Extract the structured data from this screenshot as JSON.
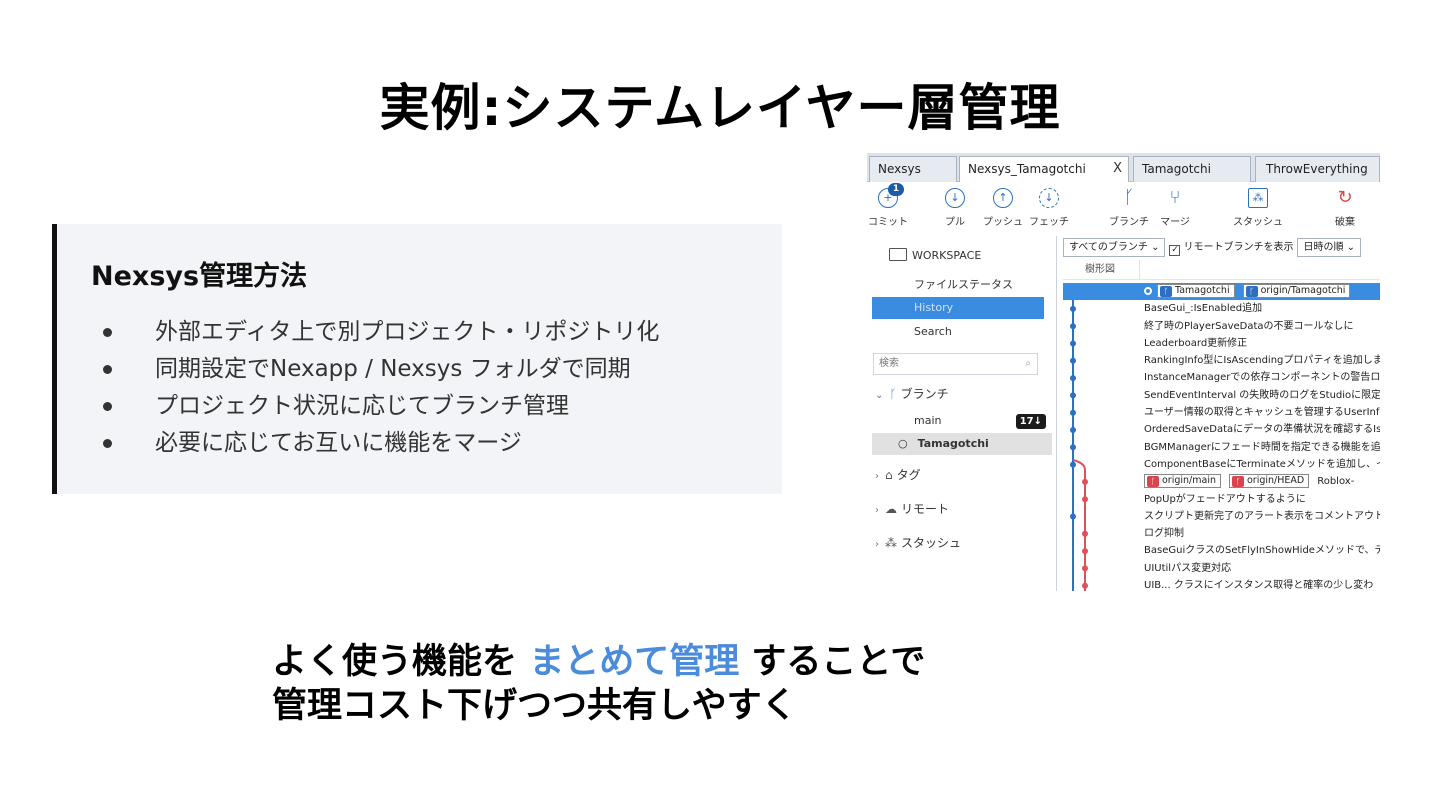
{
  "slide": {
    "title": "実例:システムレイヤー層管理",
    "info_heading": "Nexsys管理方法",
    "bullets": [
      "外部エディタ上で別プロジェクト・リポジトリ化",
      "同期設定でNexapp / Nexsys フォルダで同期",
      "プロジェクト状況に応じてブランチ管理",
      "必要に応じてお互いに機能をマージ"
    ],
    "bottom_line1_part1": "よく使う機能を ",
    "bottom_line1_highlight": "まとめて管理",
    "bottom_line1_part2": " することで",
    "bottom_line2": "管理コスト下げつつ共有しやすく",
    "highlight_color": "#4a8bdc"
  },
  "app": {
    "tabs": [
      "Nexsys",
      "Nexsys_Tamagotchi",
      "Tamagotchi",
      "ThrowEverything"
    ],
    "tab_close": "X",
    "toolbar": {
      "commit": "コミット",
      "commit_badge": "1",
      "pull": "プル",
      "push": "プッシュ",
      "fetch": "フェッチ",
      "branch": "ブランチ",
      "merge": "マージ",
      "stash": "スタッシュ",
      "discard": "破棄"
    },
    "sidebar": {
      "workspace": "WORKSPACE",
      "items": [
        "ファイルステータス",
        "History",
        "Search"
      ],
      "search_placeholder": "検索",
      "branches_group": "ブランチ",
      "branches": [
        {
          "name": "main",
          "count": "17↓"
        },
        {
          "name": "Tamagotchi"
        }
      ],
      "tags_group": "タグ",
      "remotes_group": "リモート",
      "stashes_group": "スタッシュ"
    },
    "filters": {
      "all_branches": "すべてのブランチ ⌄",
      "show_remote": "リモートブランチを表示",
      "date_order": "日時の順 ⌄",
      "graph_col": "樹形図"
    },
    "commits": [
      {
        "tags": [
          "Tamagotchi",
          "origin/Tamagotchi"
        ],
        "message": ""
      },
      {
        "message": "BaseGui_:IsEnabled追加"
      },
      {
        "message": "終了時のPlayerSaveDataの不要コールなしに"
      },
      {
        "message": "Leaderboard更新修正"
      },
      {
        "message": "RankingInfo型にIsAscendingプロパティを追加しま"
      },
      {
        "message": "InstanceManagerでの依存コンポーネントの警告ロ"
      },
      {
        "message": "SendEventInterval の失敗時のログをStudioに限定"
      },
      {
        "message": "ユーザー情報の取得とキャッシュを管理するUserInfo"
      },
      {
        "message": "OrderedSaveDataにデータの準備状況を確認するIs"
      },
      {
        "message": "BGMManagerにフェード時間を指定できる機能を追"
      },
      {
        "message": "ComponentBaseにTerminateメソッドを追加し、イン"
      },
      {
        "tags": [
          "origin/main",
          "origin/HEAD"
        ],
        "message": "Roblox-"
      },
      {
        "message": "PopUpがフェードアウトするように"
      },
      {
        "message": "スクリプト更新完了のアラート表示をコメントアウト"
      },
      {
        "message": "ログ抑制"
      },
      {
        "message": "BaseGuiクラスのSetFlyInShowHideメソッドで、デフ"
      },
      {
        "message": "UIUtilパス変更対応"
      },
      {
        "message": "UIB... クラスにインスタンス取得と確率の少し変わ"
      }
    ]
  }
}
